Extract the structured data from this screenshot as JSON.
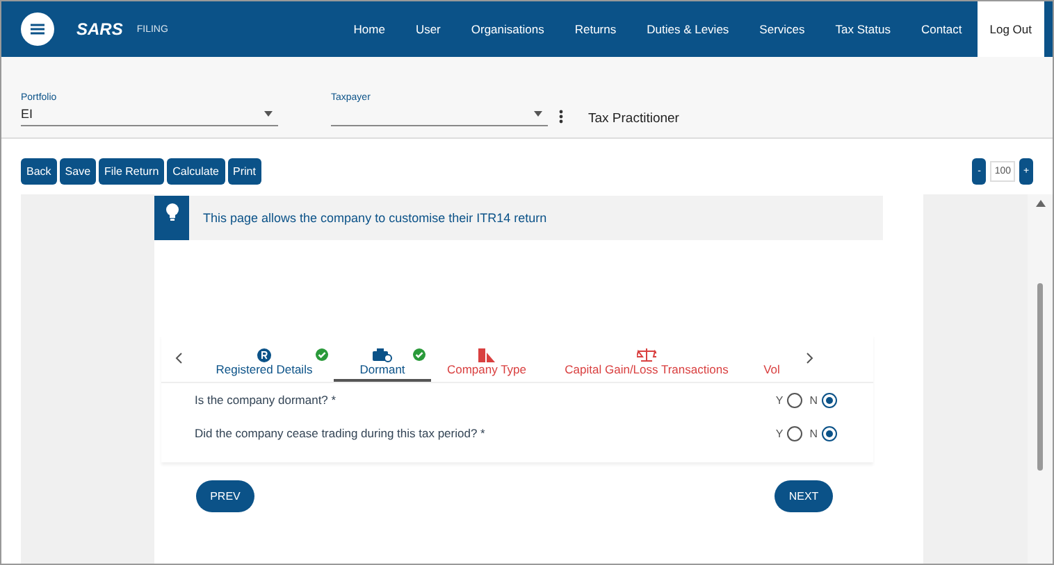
{
  "header": {
    "logo": "SARS",
    "brand": "FILING",
    "nav": [
      {
        "label": "Home",
        "selected": false
      },
      {
        "label": "User",
        "selected": false
      },
      {
        "label": "Organisations",
        "selected": false
      },
      {
        "label": "Returns",
        "selected": false
      },
      {
        "label": "Duties & Levies",
        "selected": false
      },
      {
        "label": "Services",
        "selected": false
      },
      {
        "label": "Tax Status",
        "selected": false
      },
      {
        "label": "Contact",
        "selected": false
      },
      {
        "label": "Log Out",
        "selected": true
      }
    ]
  },
  "filters": {
    "portfolio": {
      "label": "Portfolio",
      "value": "EI"
    },
    "taxpayer": {
      "label": "Taxpayer"
    },
    "role": "Tax Practitioner"
  },
  "toolbar": {
    "buttons": [
      "Back",
      "Save",
      "File Return",
      "Calculate",
      "Print"
    ],
    "zoom": {
      "minus": "-",
      "value": "100",
      "plus": "+"
    }
  },
  "info": "This page allows the company to customise their ITR14 return",
  "steps": [
    {
      "label": "Registered Details",
      "kind": "registered",
      "done": true,
      "selected": false
    },
    {
      "label": "Dormant",
      "kind": "briefcase",
      "done": true,
      "selected": true
    },
    {
      "label": "Company Type",
      "kind": "building",
      "done": false,
      "selected": false
    },
    {
      "label": "Capital Gain/Loss Transactions",
      "kind": "scale",
      "done": false,
      "selected": false
    },
    {
      "label": "Vol",
      "kind": "plain",
      "done": false,
      "selected": false
    }
  ],
  "questions": [
    {
      "text": "Is the company dormant? *",
      "options": [
        {
          "label": "Y",
          "selected": false
        },
        {
          "label": "N",
          "selected": true
        }
      ]
    },
    {
      "text": "Did the company cease trading during this tax period? *",
      "options": [
        {
          "label": "Y",
          "selected": false
        },
        {
          "label": "N",
          "selected": true
        }
      ]
    }
  ],
  "nav_buttons": {
    "prev": "PREV",
    "next": "NEXT"
  }
}
